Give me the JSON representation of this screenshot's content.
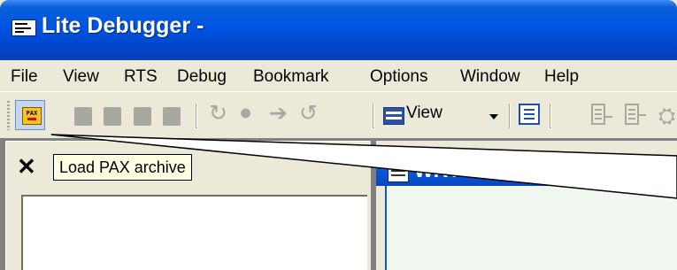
{
  "window": {
    "title": "Lite Debugger -"
  },
  "menu": {
    "items": [
      "File",
      "View",
      "RTS",
      "Debug",
      "Bookmark",
      "Options",
      "Window",
      "Help"
    ]
  },
  "toolbar": {
    "pax_button_text": "PAX",
    "view_label": "View"
  },
  "tooltip": {
    "text": "Load PAX archive"
  },
  "panels": {
    "left_close_glyph": "✕",
    "right_title": "WRTS Station Display"
  },
  "colors": {
    "titlebar": "#0054e3",
    "chrome": "#ece9d8",
    "tooltip_bg": "#ffffe1"
  }
}
